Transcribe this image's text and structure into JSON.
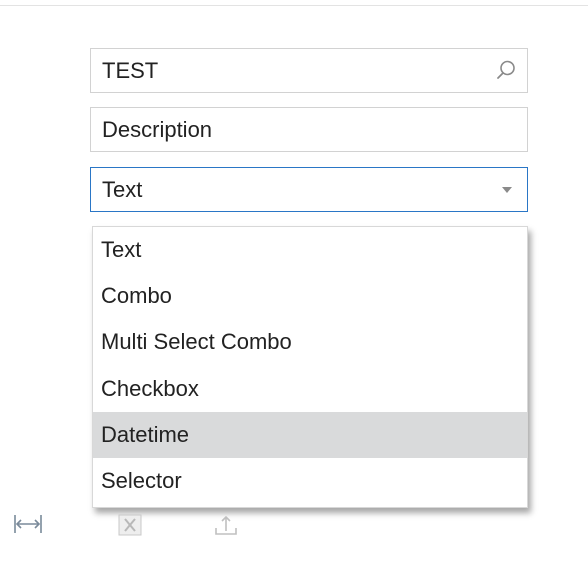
{
  "form": {
    "id_value": "TEST",
    "description_value": "Description",
    "type_selected": "Text"
  },
  "dropdown": {
    "options": [
      "Text",
      "Combo",
      "Multi Select Combo",
      "Checkbox",
      "Datetime",
      "Selector"
    ],
    "highlighted": "Datetime"
  },
  "icons": {
    "search": "search-icon",
    "dropdown": "chevron-down-icon",
    "fit_columns": "fit-columns-icon",
    "export_excel": "excel-export-icon",
    "upload": "upload-icon"
  },
  "colors": {
    "focus_border": "#2a76c6",
    "field_border": "#d2d2d2",
    "highlight": "#d9dadb"
  }
}
